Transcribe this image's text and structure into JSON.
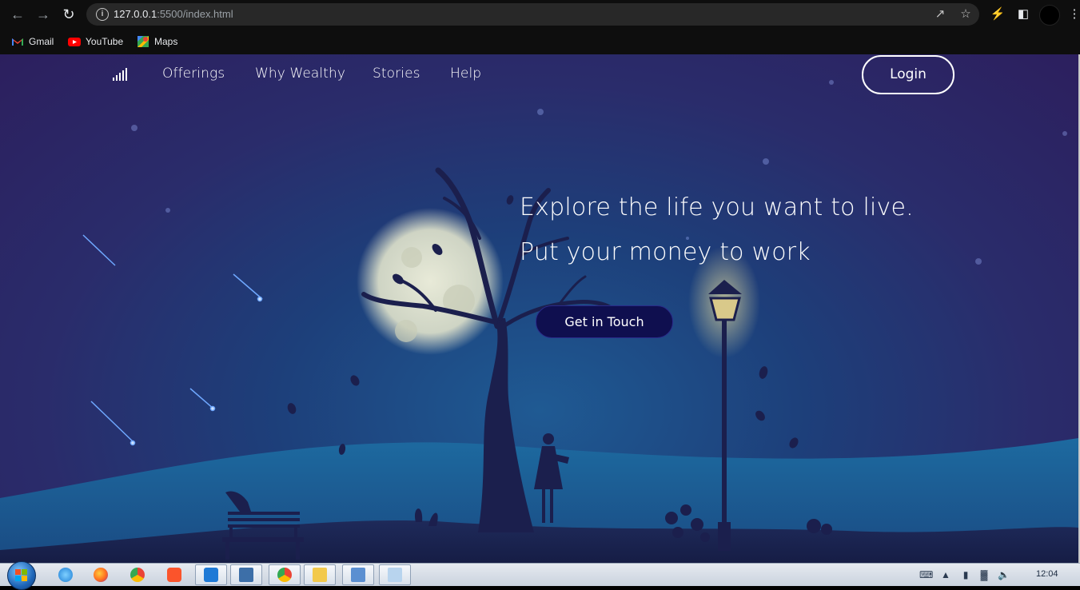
{
  "browser": {
    "url_host": "127.0.0.1",
    "url_rest": ":5500/index.html",
    "bookmarks": [
      {
        "label": "Gmail",
        "icon": "gmail-icon"
      },
      {
        "label": "YouTube",
        "icon": "youtube-icon"
      },
      {
        "label": "Maps",
        "icon": "maps-icon"
      }
    ]
  },
  "site": {
    "nav": [
      "Offerings",
      "Why Wealthy",
      "Stories",
      "Help"
    ],
    "login_label": "Login",
    "headline_1": "Explore the life you want to live.",
    "headline_2": "Put your money to work",
    "cta_label": "Get in Touch"
  },
  "taskbar": {
    "clock": "12:04",
    "apps": [
      "internet-explorer-icon",
      "firefox-icon",
      "chrome-icon",
      "brave-icon",
      "vscode-icon",
      "screen-tool-icon",
      "chrome-icon",
      "file-explorer-icon",
      "remote-desktop-icon",
      "notepad-icon"
    ]
  },
  "colors": {
    "accent_button": "#0f0f4f",
    "sky_top": "#2c1f5e",
    "sky_center": "#1f5a93"
  }
}
